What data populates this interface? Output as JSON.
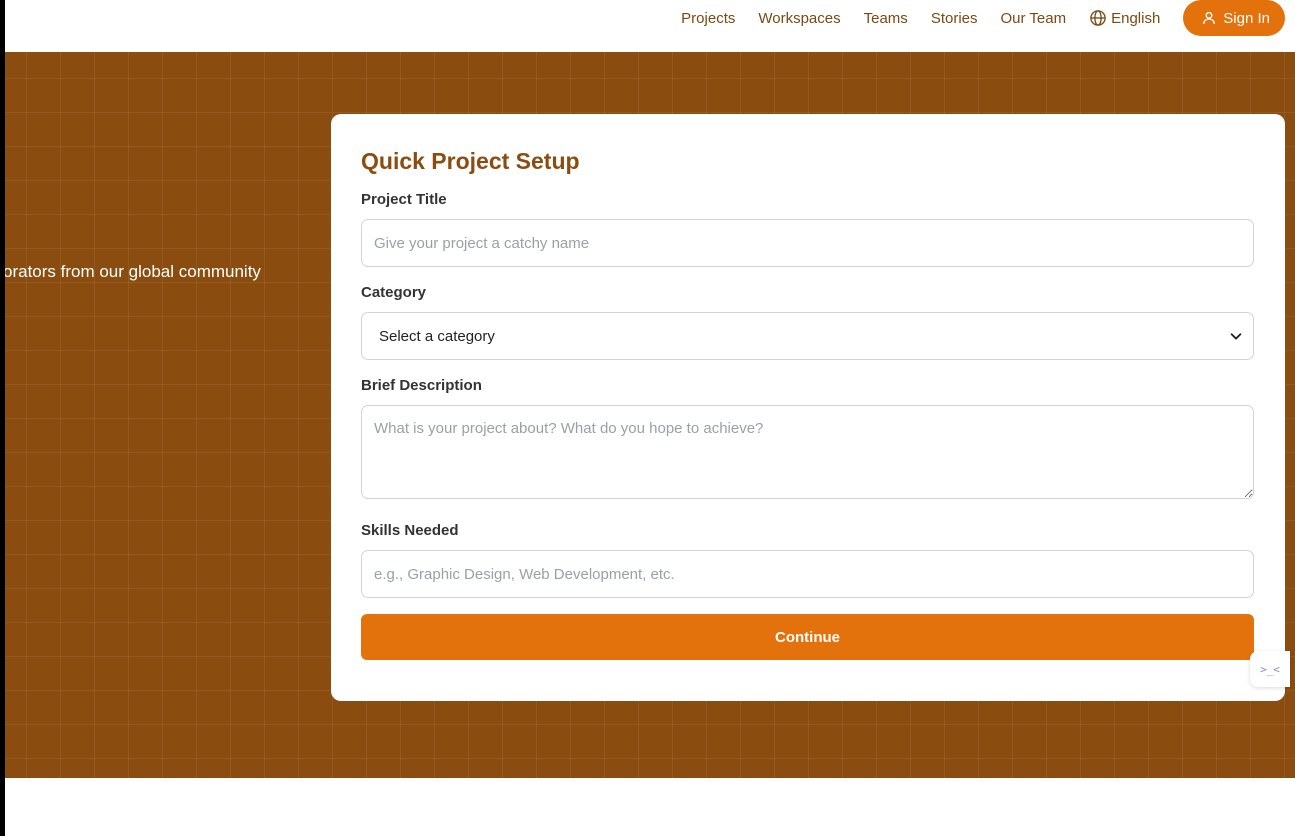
{
  "nav": {
    "links": [
      "Projects",
      "Workspaces",
      "Teams",
      "Stories",
      "Our Team"
    ],
    "language": "English",
    "signin_label": "Sign In"
  },
  "hero": {
    "subtitle": "orators from our global community"
  },
  "form": {
    "title": "Quick Project Setup",
    "project_title_label": "Project Title",
    "project_title_placeholder": "Give your project a catchy name",
    "category_label": "Category",
    "category_selected": "Select a category",
    "description_label": "Brief Description",
    "description_placeholder": "What is your project about? What do you hope to achieve?",
    "skills_label": "Skills Needed",
    "skills_placeholder": "e.g., Graphic Design, Web Development, etc.",
    "continue_label": "Continue"
  },
  "side_tab": {
    "glyph": ">_<"
  },
  "colors": {
    "brand_brown": "#8b4c10",
    "accent_orange": "#e4720c",
    "nav_text": "#7a4a14"
  },
  "icons": {
    "language": "globe-icon",
    "signin": "user-icon",
    "select": "chevron-down-icon"
  }
}
